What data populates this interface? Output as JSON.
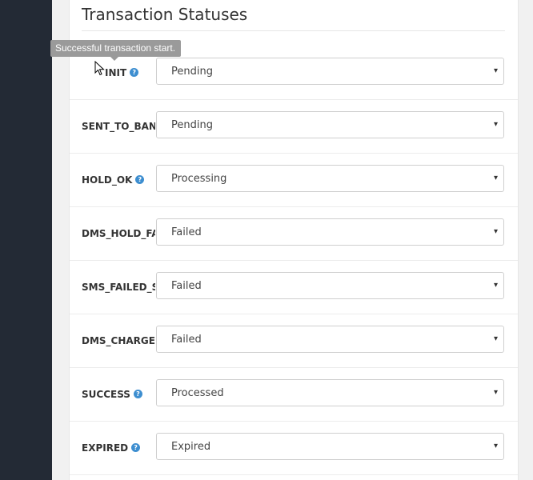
{
  "panel": {
    "title": "Transaction Statuses"
  },
  "tooltip": {
    "text": "Successful transaction start."
  },
  "rows": [
    {
      "label": "INIT",
      "help": true,
      "value": "Pending"
    },
    {
      "label": "SENT_TO_BANK",
      "help": false,
      "value": "Pending"
    },
    {
      "label": "HOLD_OK",
      "help": true,
      "value": "Processing"
    },
    {
      "label": "DMS_HOLD_FAILED",
      "help": false,
      "value": "Failed"
    },
    {
      "label": "SMS_FAILED_SMS",
      "help": false,
      "value": "Failed"
    },
    {
      "label": "DMS_CHARGE_FAILED",
      "help": false,
      "value": "Failed"
    },
    {
      "label": "SUCCESS",
      "help": true,
      "value": "Processed"
    },
    {
      "label": "EXPIRED",
      "help": true,
      "value": "Expired"
    }
  ],
  "help_icon_glyph": "?",
  "caret_glyph": "▾",
  "colors": {
    "sidebar": "#232a35",
    "help_icon": "#3d8ed0",
    "tooltip": "#9a9a9a"
  }
}
